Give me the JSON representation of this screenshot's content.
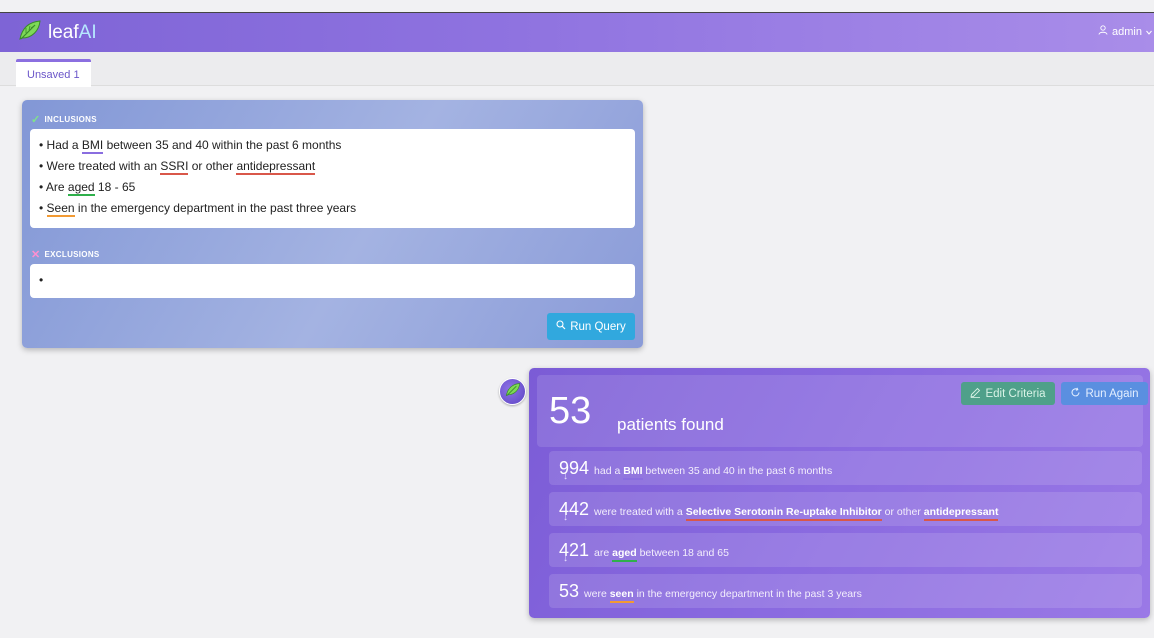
{
  "app": {
    "brand_main": "leaf",
    "brand_accent": "AI",
    "user": "admin"
  },
  "tabs": [
    {
      "label": "Unsaved 1",
      "active": true
    }
  ],
  "criteria": {
    "inclusions_label": "INCLUSIONS",
    "exclusions_label": "EXCLUSIONS",
    "run_button": "Run Query",
    "inclusions": [
      {
        "pre": "Had a ",
        "term": "BMI",
        "post": " between 35 and 40 within the past 6 months"
      },
      {
        "pre": "Were treated with an ",
        "term": "SSRI",
        "mid": " or other ",
        "term2": "antidepressant",
        "post": ""
      },
      {
        "pre": "Are ",
        "term": "aged",
        "post": " 18 - 65"
      },
      {
        "pre": "",
        "term": "Seen",
        "post": " in the emergency department in the past three years"
      }
    ],
    "exclusions_bullet": "•",
    "bullet": "•"
  },
  "result": {
    "count": "53",
    "count_label": "patients found",
    "edit_button": "Edit Criteria",
    "again_button": "Run Again",
    "arrow": "↓",
    "steps": [
      {
        "num": "994",
        "pre": "had a",
        "term": "BMI",
        "post": "between 35 and 40 in the past 6 months"
      },
      {
        "num": "442",
        "pre": "were treated with a",
        "term": "Selective Serotonin Re-uptake Inhibitor",
        "mid": "or other",
        "term2": "antidepressant",
        "post": ""
      },
      {
        "num": "421",
        "pre": "are",
        "term": "aged",
        "post": "between 18 and 65"
      },
      {
        "num": "53",
        "pre": "were",
        "term": "seen",
        "post": "in the emergency department in the past 3 years"
      }
    ]
  },
  "colors": {
    "accent": "#8b6fe0",
    "run": "#31a8de",
    "edit": "#4fa08a",
    "again": "#5a8fe0"
  }
}
